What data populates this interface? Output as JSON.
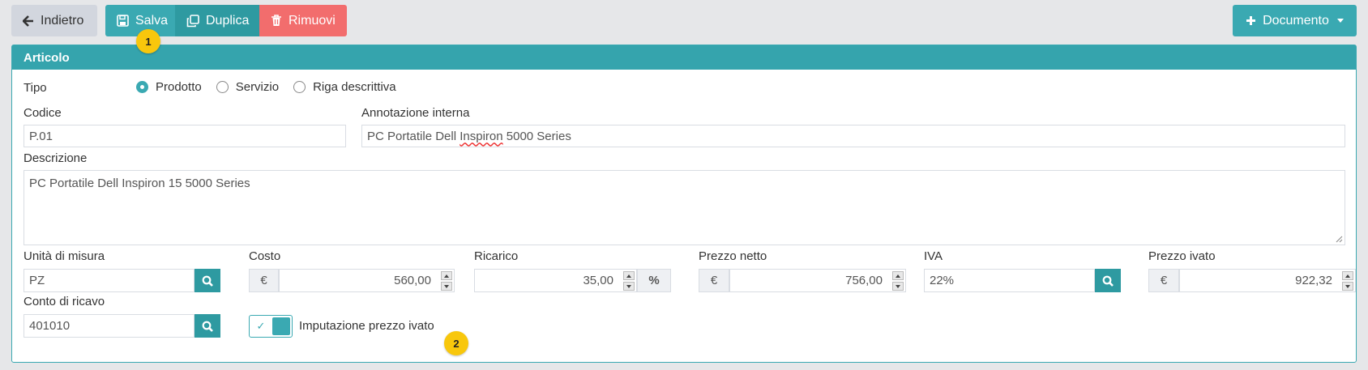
{
  "toolbar": {
    "back_label": "Indietro",
    "save_label": "Salva",
    "duplicate_label": "Duplica",
    "remove_label": "Rimuovi",
    "document_label": "Documento"
  },
  "markers": {
    "one": "1",
    "two": "2"
  },
  "panel": {
    "title": "Articolo"
  },
  "form": {
    "tipo": {
      "label": "Tipo",
      "options": [
        "Prodotto",
        "Servizio",
        "Riga descrittiva"
      ],
      "selected": "Prodotto"
    },
    "codice": {
      "label": "Codice",
      "value": "P.01"
    },
    "annotazione": {
      "label": "Annotazione interna",
      "value_part1": "PC Portatile Dell ",
      "value_part2": "Inspiron",
      "value_part3": " 5000 Series"
    },
    "descrizione": {
      "label": "Descrizione",
      "value": "PC Portatile Dell Inspiron 15 5000 Series"
    },
    "unita": {
      "label": "Unità di misura",
      "value": "PZ"
    },
    "costo": {
      "label": "Costo",
      "currency": "€",
      "value": "560,00"
    },
    "ricarico": {
      "label": "Ricarico",
      "value": "35,00",
      "unit": "%"
    },
    "prezzo_netto": {
      "label": "Prezzo netto",
      "currency": "€",
      "value": "756,00"
    },
    "iva": {
      "label": "IVA",
      "value": "22%"
    },
    "prezzo_ivato": {
      "label": "Prezzo ivato",
      "currency": "€",
      "value": "922,32"
    },
    "conto": {
      "label": "Conto di ricavo",
      "value": "401010"
    },
    "imputazione": {
      "label": "Imputazione prezzo ivato",
      "checked": true
    }
  },
  "colors": {
    "accent": "#3aa9b2",
    "accent_dark": "#2e9aa1",
    "danger": "#f26d6d",
    "marker": "#f8c70c"
  }
}
